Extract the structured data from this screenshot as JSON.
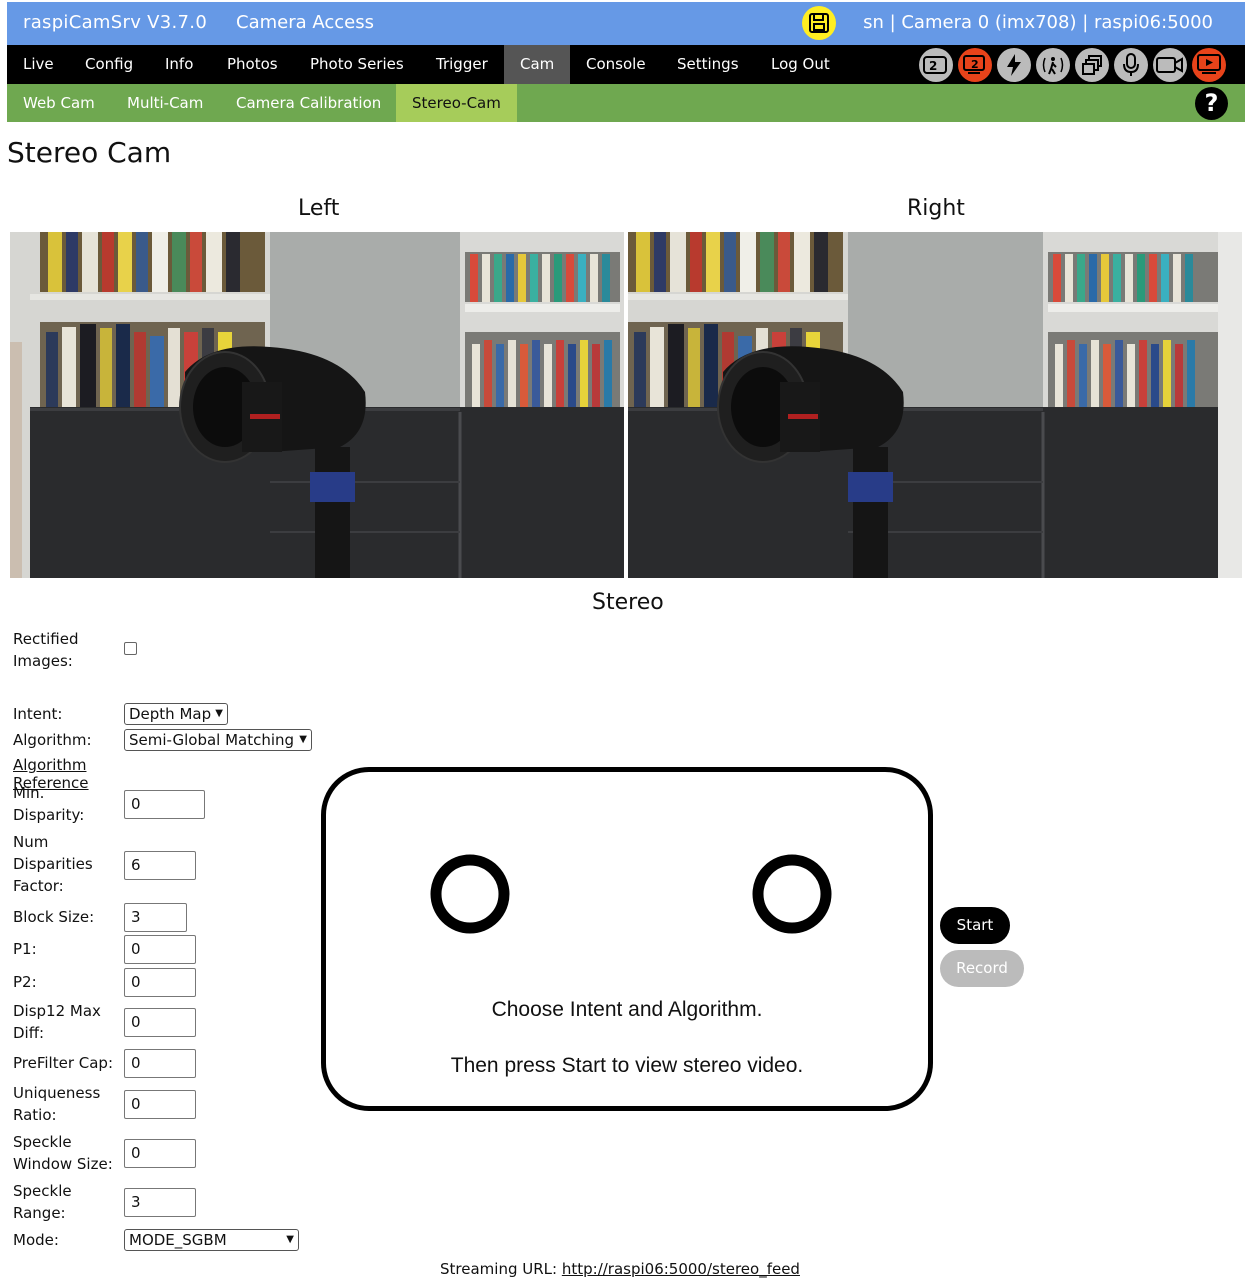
{
  "header": {
    "app_title": "raspiCamSrv V3.7.0",
    "access_title": "Camera Access",
    "status": "sn | Camera 0 (imx708) | raspi06:5000"
  },
  "nav": {
    "items": [
      "Live",
      "Config",
      "Info",
      "Photos",
      "Photo Series",
      "Trigger",
      "Cam",
      "Console",
      "Settings",
      "Log Out"
    ],
    "active": "Cam",
    "icons": [
      "dual-camera-icon",
      "camera-2-icon",
      "flash-icon",
      "motion-sensor-icon",
      "windows-icon",
      "microphone-icon",
      "video-camera-icon",
      "stream-icon"
    ]
  },
  "subnav": {
    "items": [
      "Web Cam",
      "Multi-Cam",
      "Camera Calibration",
      "Stereo-Cam"
    ],
    "active": "Stereo-Cam",
    "help": "?"
  },
  "page": {
    "title": "Stereo Cam",
    "left_label": "Left",
    "right_label": "Right",
    "stereo_label": "Stereo"
  },
  "form": {
    "rectified_label": "Rectified Images:",
    "rectified_checked": false,
    "intent_label": "Intent:",
    "intent_value": "Depth Map",
    "algorithm_label": "Algorithm:",
    "algorithm_value": "Semi-Global Matching",
    "algorithm_reference": "Algorithm Reference",
    "min_disparity_label": "Min. Disparity:",
    "min_disparity": "0",
    "num_disparities_label": "Num Disparities Factor:",
    "num_disparities": "6",
    "block_size_label": "Block Size:",
    "block_size": "3",
    "p1_label": "P1:",
    "p1": "0",
    "p2_label": "P2:",
    "p2": "0",
    "disp12_label": "Disp12 Max Diff:",
    "disp12": "0",
    "prefilter_label": "PreFilter Cap:",
    "prefilter": "0",
    "uniqueness_label": "Uniqueness Ratio:",
    "uniqueness": "0",
    "speckle_window_label": "Speckle Window Size:",
    "speckle_window": "0",
    "speckle_range_label": "Speckle Range:",
    "speckle_range": "3",
    "mode_label": "Mode:",
    "mode_value": "MODE_SGBM"
  },
  "placeholder": {
    "line1": "Choose Intent and Algorithm.",
    "line2": "Then press Start to view stereo video."
  },
  "buttons": {
    "start": "Start",
    "record": "Record"
  },
  "stream": {
    "label": "Streaming URL:",
    "url": "http://raspi06:5000/stereo_feed"
  }
}
